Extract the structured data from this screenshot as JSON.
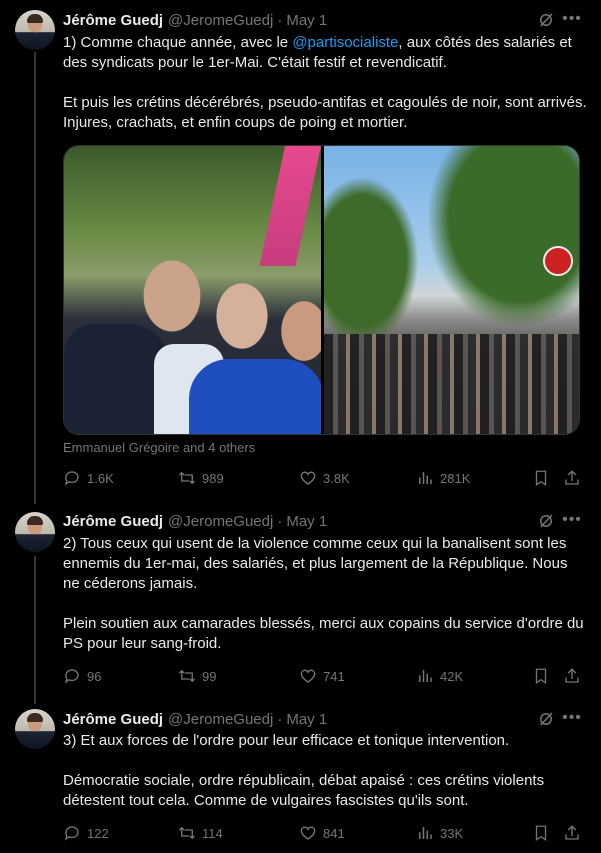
{
  "tweets": [
    {
      "name": "Jérôme Guedj",
      "handle": "@JeromeGuedj",
      "separator": "·",
      "date": "May 1",
      "text_parts": {
        "p1_before": "1) Comme chaque année, avec le ",
        "p1_mention": "@partisocialiste",
        "p1_after": ", aux côtés des salariés et des syndicats pour le 1er-Mai. C'était festif et revendicatif.",
        "p2": "Et puis les crétins décérébrés, pseudo-antifas et cagoulés de noir, sont arrivés. Injures, crachats, et enfin coups de poing et mortier."
      },
      "media_caption": "Emmanuel Grégoire and 4 others",
      "stats": {
        "replies": "1.6K",
        "reposts": "989",
        "likes": "3.8K",
        "views": "281K"
      }
    },
    {
      "name": "Jérôme Guedj",
      "handle": "@JeromeGuedj",
      "separator": "·",
      "date": "May 1",
      "text_parts": {
        "p1": "2) Tous ceux qui usent de la  violence comme ceux qui la banalisent sont les ennemis du 1er-mai, des salariés, et plus largement de la République. Nous ne céderons jamais.",
        "p2": "Plein soutien aux camarades blessés, merci aux copains du service d'ordre du PS pour leur sang-froid."
      },
      "stats": {
        "replies": "96",
        "reposts": "99",
        "likes": "741",
        "views": "42K"
      }
    },
    {
      "name": "Jérôme Guedj",
      "handle": "@JeromeGuedj",
      "separator": "·",
      "date": "May 1",
      "text_parts": {
        "p1": "3) Et aux forces de l'ordre pour leur efficace et tonique intervention.",
        "p2": "Démocratie sociale, ordre républicain, débat apaisé : ces crétins violents détestent tout cela. Comme de vulgaires fascistes qu'ils sont."
      },
      "stats": {
        "replies": "122",
        "reposts": "114",
        "likes": "841",
        "views": "33K"
      }
    }
  ],
  "icons": {
    "more": "more-horizontal-icon",
    "grok": "grok-icon",
    "reply": "reply-icon",
    "repost": "repost-icon",
    "like": "heart-icon",
    "views": "views-icon",
    "bookmark": "bookmark-icon",
    "share": "share-icon"
  },
  "colors": {
    "background": "#000000",
    "text": "#e7e9ea",
    "muted": "#71767b",
    "link": "#1d9bf0",
    "divider": "#2f3336"
  }
}
